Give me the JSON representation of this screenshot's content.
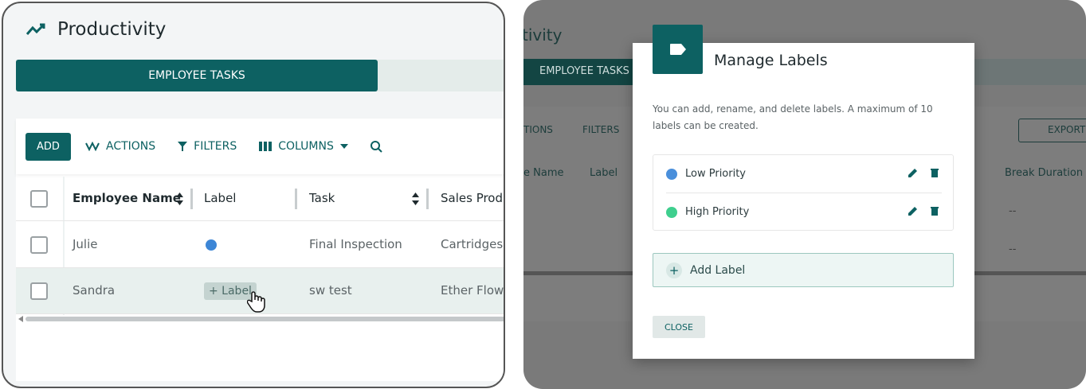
{
  "left": {
    "title": "Productivity",
    "tab_active": "EMPLOYEE TASKS",
    "toolbar": {
      "add": "ADD",
      "actions": "ACTIONS",
      "filters": "FILTERS",
      "columns": "COLUMNS"
    },
    "columns": [
      "Employee Name",
      "Label",
      "Task",
      "Sales Produ"
    ],
    "rows": [
      {
        "name": "Julie",
        "task": "Final Inspection",
        "product": "Cartridges ("
      },
      {
        "name": "Sandra",
        "label_chip": "+ Label",
        "task": "sw test",
        "product": "Ether Flowe"
      }
    ]
  },
  "right": {
    "bg": {
      "title": "tivity",
      "tab": "EMPLOYEE TASKS",
      "actions_partial": "TIONS",
      "filters": "FILTERS",
      "export": "EXPORT",
      "col_name": "e Name",
      "col_label": "Label",
      "col_break": "Break Duration",
      "dash1": "--",
      "dash2": "--"
    },
    "modal": {
      "title": "Manage Labels",
      "desc": "You can add, rename, and delete labels. A maximum of 10 labels can be created.",
      "labels": [
        {
          "name": "Low Priority",
          "color": "#4a8fdb"
        },
        {
          "name": "High Priority",
          "color": "#3fcf8e"
        }
      ],
      "add_label": "Add Label",
      "close": "CLOSE"
    }
  },
  "colors": {
    "accent": "#0d6162",
    "label_dot_julie": "#3d86d6"
  }
}
